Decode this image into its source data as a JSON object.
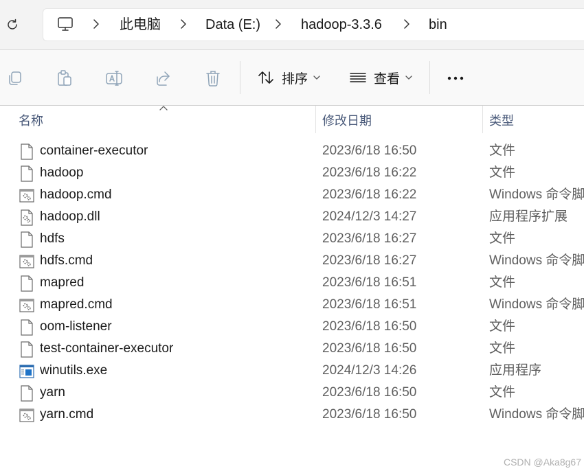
{
  "address": {
    "crumbs": [
      "此电脑",
      "Data (E:)",
      "hadoop-3.3.6",
      "bin"
    ]
  },
  "toolbar": {
    "sort_label": "排序",
    "view_label": "查看"
  },
  "columns": {
    "name": "名称",
    "date": "修改日期",
    "type": "类型"
  },
  "files": [
    {
      "name": "container-executor",
      "date": "2023/6/18 16:50",
      "type": "文件",
      "icon": "file-icon"
    },
    {
      "name": "hadoop",
      "date": "2023/6/18 16:22",
      "type": "文件",
      "icon": "file-icon"
    },
    {
      "name": "hadoop.cmd",
      "date": "2023/6/18 16:22",
      "type": "Windows 命令脚本",
      "icon": "cmd-script-icon"
    },
    {
      "name": "hadoop.dll",
      "date": "2024/12/3 14:27",
      "type": "应用程序扩展",
      "icon": "dll-icon"
    },
    {
      "name": "hdfs",
      "date": "2023/6/18 16:27",
      "type": "文件",
      "icon": "file-icon"
    },
    {
      "name": "hdfs.cmd",
      "date": "2023/6/18 16:27",
      "type": "Windows 命令脚本",
      "icon": "cmd-script-icon"
    },
    {
      "name": "mapred",
      "date": "2023/6/18 16:51",
      "type": "文件",
      "icon": "file-icon"
    },
    {
      "name": "mapred.cmd",
      "date": "2023/6/18 16:51",
      "type": "Windows 命令脚本",
      "icon": "cmd-script-icon"
    },
    {
      "name": "oom-listener",
      "date": "2023/6/18 16:50",
      "type": "文件",
      "icon": "file-icon"
    },
    {
      "name": "test-container-executor",
      "date": "2023/6/18 16:50",
      "type": "文件",
      "icon": "file-icon"
    },
    {
      "name": "winutils.exe",
      "date": "2024/12/3 14:26",
      "type": "应用程序",
      "icon": "exe-icon"
    },
    {
      "name": "yarn",
      "date": "2023/6/18 16:50",
      "type": "文件",
      "icon": "file-icon"
    },
    {
      "name": "yarn.cmd",
      "date": "2023/6/18 16:50",
      "type": "Windows 命令脚本",
      "icon": "cmd-script-icon"
    }
  ],
  "watermark": "CSDN @Aka8g67"
}
